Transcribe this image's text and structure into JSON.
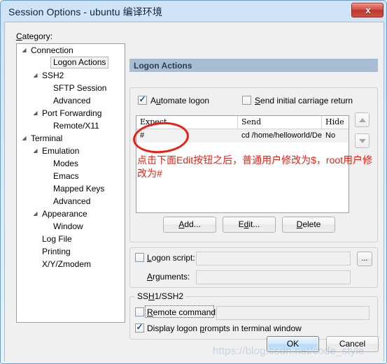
{
  "window": {
    "title": "Session Options - ubuntu 编译环境",
    "close_label": "x"
  },
  "sidebar": {
    "category_label": "Category:",
    "items": [
      {
        "label": "Connection",
        "indent": 0,
        "expander": "expanded",
        "selected": false
      },
      {
        "label": "Logon Actions",
        "indent": 2,
        "expander": "none",
        "selected": true
      },
      {
        "label": "SSH2",
        "indent": 1,
        "expander": "expanded",
        "selected": false
      },
      {
        "label": "SFTP Session",
        "indent": 2,
        "expander": "none",
        "selected": false
      },
      {
        "label": "Advanced",
        "indent": 2,
        "expander": "none",
        "selected": false
      },
      {
        "label": "Port Forwarding",
        "indent": 1,
        "expander": "expanded",
        "selected": false
      },
      {
        "label": "Remote/X11",
        "indent": 2,
        "expander": "none",
        "selected": false
      },
      {
        "label": "Terminal",
        "indent": 0,
        "expander": "expanded",
        "selected": false
      },
      {
        "label": "Emulation",
        "indent": 1,
        "expander": "expanded",
        "selected": false
      },
      {
        "label": "Modes",
        "indent": 2,
        "expander": "none",
        "selected": false
      },
      {
        "label": "Emacs",
        "indent": 2,
        "expander": "none",
        "selected": false
      },
      {
        "label": "Mapped Keys",
        "indent": 2,
        "expander": "none",
        "selected": false
      },
      {
        "label": "Advanced",
        "indent": 2,
        "expander": "none",
        "selected": false
      },
      {
        "label": "Appearance",
        "indent": 1,
        "expander": "expanded",
        "selected": false
      },
      {
        "label": "Window",
        "indent": 2,
        "expander": "none",
        "selected": false
      },
      {
        "label": "Log File",
        "indent": 1,
        "expander": "none",
        "selected": false
      },
      {
        "label": "Printing",
        "indent": 1,
        "expander": "none",
        "selected": false
      },
      {
        "label": "X/Y/Zmodem",
        "indent": 1,
        "expander": "none",
        "selected": false
      }
    ]
  },
  "panel": {
    "header": "Logon Actions",
    "automate_logon": {
      "label": "Automate logon",
      "checked": true
    },
    "send_initial_cr": {
      "label": "Send initial carriage return",
      "checked": false
    },
    "list": {
      "columns": [
        "Expect",
        "Send",
        "Hide"
      ],
      "rows": [
        {
          "expect": "#",
          "send": "cd /home/helloworld/De...",
          "hide": "No"
        }
      ]
    },
    "scroll_up_icon": "triangle-up-icon",
    "scroll_down_icon": "triangle-down-icon",
    "buttons": {
      "add": "Add...",
      "edit": "Edit...",
      "delete": "Delete"
    },
    "annotation": {
      "text": "点击下面Edit按钮之后，普通用户修改为$，root用户修改为#",
      "color": "#f51b10",
      "shape": "ellipse-highlight"
    },
    "logon_script": {
      "label": "Logon script:",
      "checked": false,
      "value": "",
      "browse_label": "..."
    },
    "arguments": {
      "label": "Arguments:",
      "value": ""
    },
    "ssh_group": {
      "title": "SSH1/SSH2",
      "remote_command": {
        "label": "Remote command:",
        "checked": false,
        "value": ""
      },
      "display_prompts": {
        "label": "Display logon prompts in terminal window",
        "checked": true
      }
    }
  },
  "footer": {
    "ok": "OK",
    "cancel": "Cancel"
  },
  "watermark": "https://blog.csdn.net/code_style",
  "colors": {
    "titlebar_accent": "#cfe3f7",
    "panel_header": "#a8bdd4",
    "annotation_red": "#f51b10",
    "close_button": "#c0392b",
    "default_button": "#4e86c0"
  }
}
